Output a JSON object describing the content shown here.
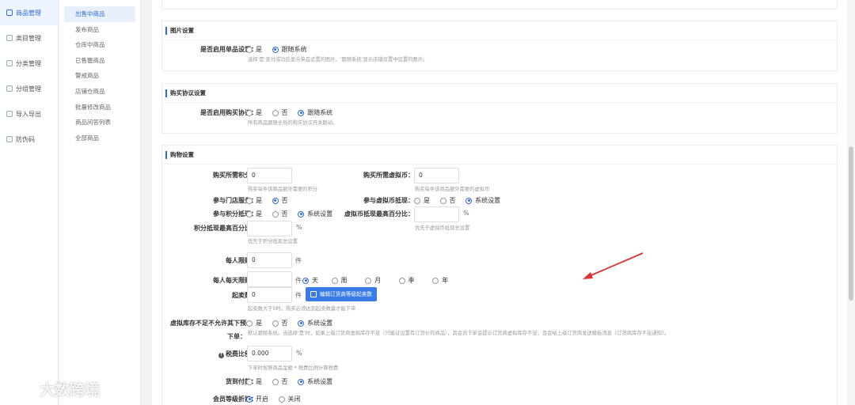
{
  "sidebar_primary": [
    {
      "label": "商品管理",
      "active": true
    },
    {
      "label": "类目管理"
    },
    {
      "label": "分类管理"
    },
    {
      "label": "分组管理"
    },
    {
      "label": "导入导出"
    },
    {
      "label": "防伪码"
    }
  ],
  "sidebar_secondary": [
    {
      "label": "出售中商品",
      "active": true
    },
    {
      "label": "发布商品"
    },
    {
      "label": "仓库中商品"
    },
    {
      "label": "已售罄商品"
    },
    {
      "label": "警戒商品"
    },
    {
      "label": "店铺仓商品"
    },
    {
      "label": "批量修改商品"
    },
    {
      "label": "商品问答列表"
    },
    {
      "label": "全部商品"
    }
  ],
  "image_settings": {
    "title": "图片设置",
    "enable_single_label": "是否启用单品设置：",
    "options": [
      "是",
      "跟随系统"
    ],
    "help": "选择'是'支付成功后显示单品设置的图片，'跟随系统'显示店铺设置中设置的图片。"
  },
  "agreement_settings": {
    "title": "购买协议设置",
    "enable_label": "是否启用购买协议：",
    "options": [
      "是",
      "否",
      "跟随系统"
    ],
    "help": "所有商品跟随全局的购买协议开关联动。"
  },
  "shopping": {
    "title": "购物设置",
    "points_label": "购买所需积分：",
    "points_value": "0",
    "points_help": "购买每件该商品额外需要的积分",
    "vcoin_label": "购买所需虚拟币：",
    "vcoin_value": "0",
    "vcoin_help": "购买每件该商品额外需要的虚拟币",
    "store_service_label": "参与门店服务：",
    "store_service_options": [
      "是",
      "否"
    ],
    "vcoin_deduct_label": "参与虚拟币抵现：",
    "vcoin_deduct_options": [
      "是",
      "否",
      "系统设置"
    ],
    "points_deduct_label": "参与积分抵现：",
    "points_deduct_options": [
      "是",
      "否",
      "系统设置"
    ],
    "vcoin_max_label": "虚拟币抵现最高百分比：",
    "vcoin_max_help": "优先于虚拟币抵现总设置",
    "points_max_label": "积分抵现最高百分比：",
    "points_max_help": "优先于积分抵现总设置",
    "percent": "%",
    "per_person_label": "每人限购：",
    "per_person_value": "0",
    "unit_piece": "件",
    "daily_limit_label": "每人每天限购：",
    "daily_limit_options": [
      "天",
      "周",
      "月",
      "季",
      "年"
    ],
    "min_buy_label": "起卖数：",
    "min_buy_value": "0",
    "min_buy_button": "编辑订货商等级起卖数",
    "min_buy_help": "起卖数大于0时，购买必须达到起卖数量才能下单",
    "virtual_stock_label_1": "虚拟库存不足不允许其下预",
    "virtual_stock_label_2": "下单：",
    "virtual_stock_options": [
      "是",
      "否",
      "系统设置"
    ],
    "virtual_stock_help": "默认跟随系统。当选择'是'时，如果上级订货商虚拟库存不足（只能证设置有订货价的商品），其会员下单会提示订货商虚拟库存不足，且会给上级订货商发送模板消息（订货商库存不足通知）。",
    "tax_label": "税费比例：",
    "tax_value": "0.000",
    "tax_help": "下单时按照商品金额 * 税费比例计算税费",
    "cod_label": "货到付款：",
    "cod_options": [
      "是",
      "否",
      "系统设置"
    ],
    "member_discount_label": "会员等级折扣：",
    "member_discount_options": [
      "开启",
      "关闭"
    ]
  },
  "watermark": "大数跨境"
}
